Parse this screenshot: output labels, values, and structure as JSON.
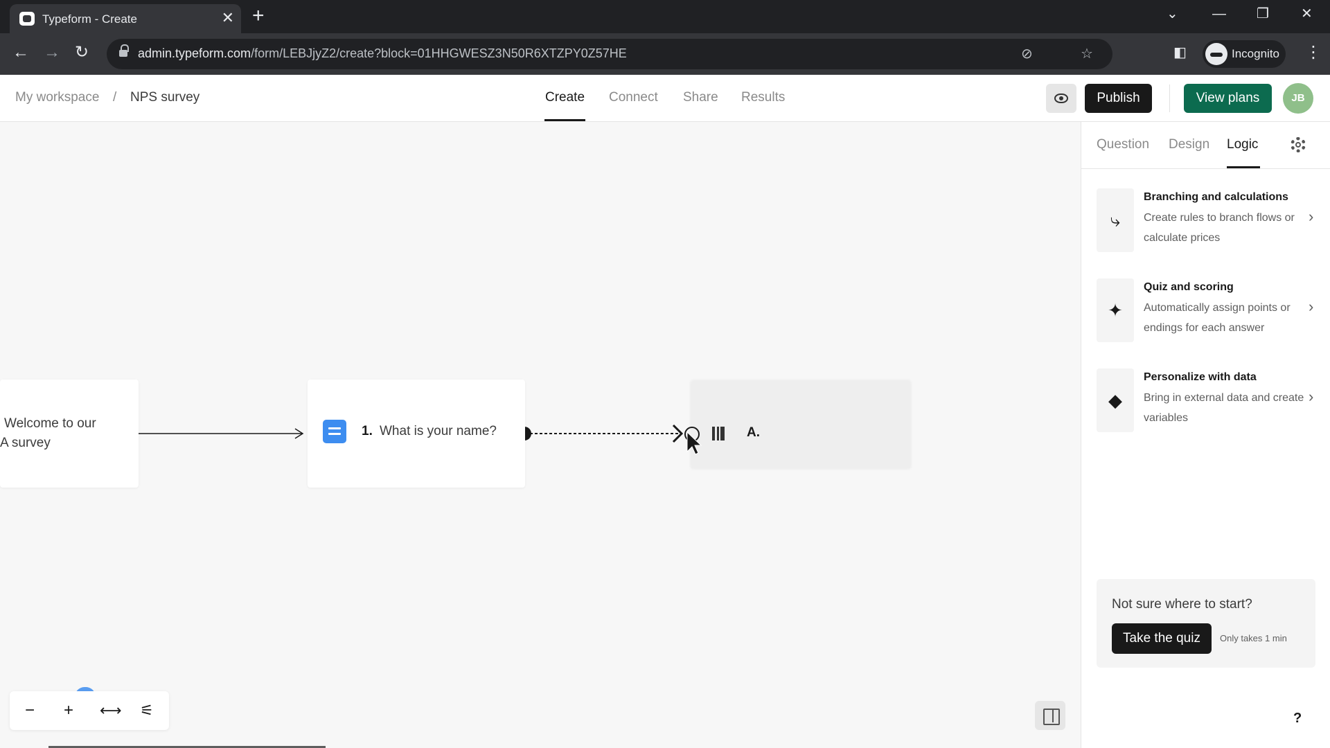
{
  "browser": {
    "tab_title": "Typeform - Create",
    "tab_close": "✕",
    "new_tab": "+",
    "url_host": "admin.typeform.com",
    "url_path": "/form/LEBJjyZ2/create?block=01HHGWESZ3N50R6XTZPY0Z57HE",
    "incognito_label": "Incognito"
  },
  "header": {
    "breadcrumbs": [
      "My workspace",
      "/",
      "NPS survey"
    ],
    "tabs": [
      {
        "label": "Create",
        "active": true
      },
      {
        "label": "Connect",
        "active": false
      },
      {
        "label": "Share",
        "active": false
      },
      {
        "label": "Results",
        "active": false
      }
    ],
    "publish_label": "Publish",
    "view_plans_label": "View plans",
    "avatar_initials": "JB",
    "accent_color": "#0c6b4f"
  },
  "canvas": {
    "welcome_text": "Welcome to our NPS survey",
    "welcome_visible_lines": [
      "Welcome to our",
      "A survey"
    ],
    "question": {
      "number": "1.",
      "text": "What is your name?",
      "icon_color": "#3d8df0"
    },
    "ghost_label": "A.",
    "zoom_controls": [
      "−",
      "+",
      "⟷",
      "⚟"
    ]
  },
  "right_panel": {
    "tabs": [
      {
        "label": "Question",
        "active": false
      },
      {
        "label": "Design",
        "active": false
      },
      {
        "label": "Logic",
        "active": true
      }
    ],
    "items": [
      {
        "title": "Branching and calculations",
        "desc": "Create rules to branch flows or calculate prices",
        "icon": "branch-icon"
      },
      {
        "title": "Quiz and scoring",
        "desc": "Automatically assign points or endings for each answer",
        "icon": "sparkle-icon"
      },
      {
        "title": "Personalize with data",
        "desc": "Bring in external data and create variables",
        "icon": "tag-icon"
      }
    ],
    "quiz_prompt": "Not sure where to start?",
    "quiz_button": "Take the quiz",
    "quiz_hint": "Only takes 1 min",
    "help": "?"
  }
}
